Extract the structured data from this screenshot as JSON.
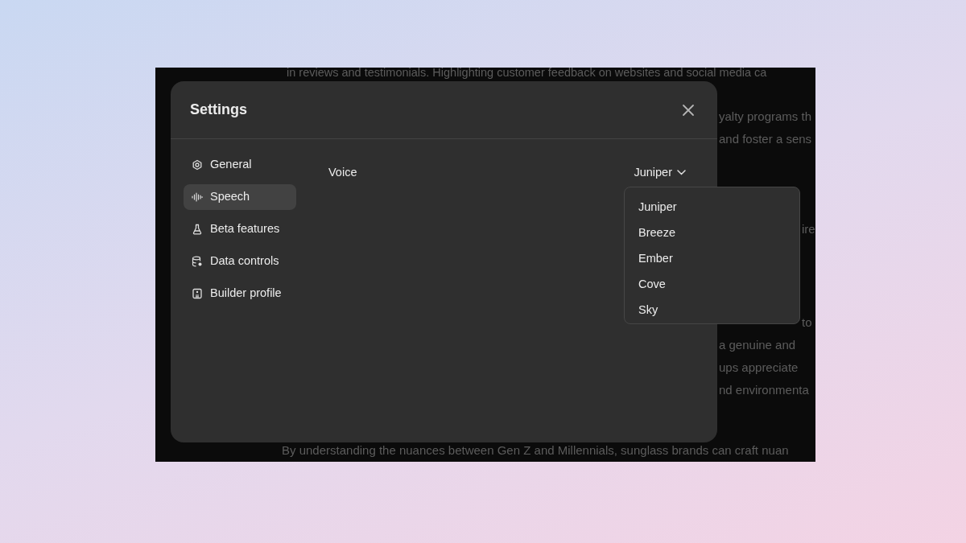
{
  "background_text": [
    {
      "text": "in reviews and testimonials. Highlighting customer feedback on websites and social media ca"
    },
    {
      "text": "yalty programs th"
    },
    {
      "text": "and foster a sens"
    },
    {
      "text": "ire"
    },
    {
      "text": "to"
    },
    {
      "text": "a genuine and"
    },
    {
      "text": "ups appreciate"
    },
    {
      "text": "nd environmenta"
    },
    {
      "text": "By understanding the nuances between Gen Z and Millennials, sunglass brands can craft nuan"
    }
  ],
  "settings": {
    "title": "Settings",
    "sidebar": {
      "items": [
        {
          "label": "General",
          "selected": false
        },
        {
          "label": "Speech",
          "selected": true
        },
        {
          "label": "Beta features",
          "selected": false
        },
        {
          "label": "Data controls",
          "selected": false
        },
        {
          "label": "Builder profile",
          "selected": false
        }
      ]
    },
    "voice": {
      "label": "Voice",
      "value": "Juniper",
      "expanded": true,
      "options": [
        {
          "label": "Juniper"
        },
        {
          "label": "Breeze"
        },
        {
          "label": "Ember"
        },
        {
          "label": "Cove"
        },
        {
          "label": "Sky"
        }
      ]
    }
  }
}
